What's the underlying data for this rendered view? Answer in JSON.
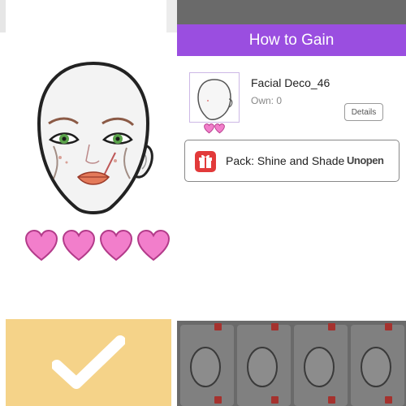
{
  "left_panel": {
    "rarity_hearts": 4,
    "confirm_icon": "checkmark-icon"
  },
  "modal": {
    "title": "How to Gain",
    "item": {
      "name": "Facial Deco_46",
      "own": "Own: 0",
      "rarity_hearts": 2,
      "details_label": "Details"
    },
    "pack": {
      "icon": "gift-icon",
      "label": "Pack: Shine and Shade",
      "status": "Unopen"
    }
  },
  "colors": {
    "header_purple": "#9a4ee0",
    "heart_pink": "#f27ecb",
    "confirm_yellow": "#f5d389",
    "pack_icon_red": "#e23a3a"
  }
}
